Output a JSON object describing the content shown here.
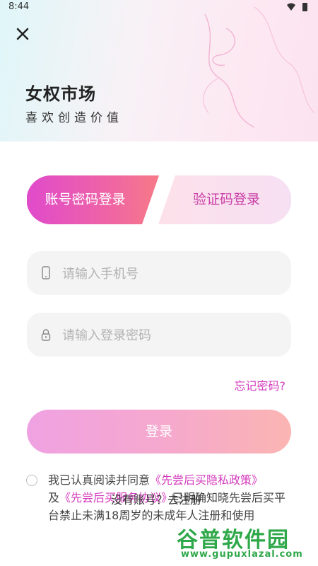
{
  "status_bar": {
    "time": "8:44"
  },
  "header": {
    "title": "女权市场",
    "slogan": "喜欢创造价值"
  },
  "tabs": {
    "account_login": "账号密码登录",
    "code_login": "验证码登录"
  },
  "form": {
    "phone_placeholder": "请输入手机号",
    "password_placeholder": "请输入登录密码",
    "forgot_password": "忘记密码?",
    "login_button": "登录"
  },
  "agreement": {
    "prefix": "我已认真阅读并同意",
    "privacy_link": "《先尝后买隐私政策》",
    "and": "及",
    "service_link": "《先尝后买服务协议》",
    "suffix": "已明确知晓先尝后买平台禁止未满18周岁的未成年人注册和使用"
  },
  "toast": "没有账号？去注册",
  "watermark": {
    "title": "谷普软件园",
    "url": "www.gupuxlazal.com"
  },
  "colors": {
    "accent": "#d33bbd",
    "tab_gradient_start": "#e04acb",
    "tab_gradient_end": "#f77a87",
    "login_button_start": "#efa2e2",
    "login_button_end": "#fbb5b2",
    "field_background": "#f4f4f4"
  },
  "icons": [
    "close-icon",
    "wifi-icon",
    "battery-icon",
    "phone-icon",
    "lock-icon",
    "checkbox-circle"
  ]
}
